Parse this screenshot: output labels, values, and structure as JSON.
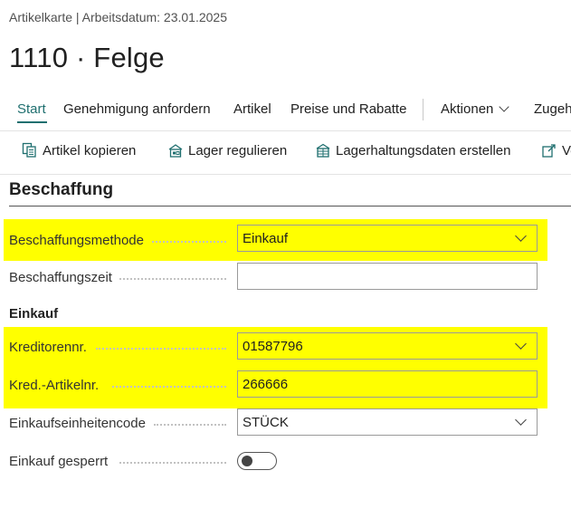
{
  "header": {
    "breadcrumb": "Artikelkarte | Arbeitsdatum: 23.01.2025",
    "title": "1110 · Felge"
  },
  "tabs": [
    {
      "label": "Start",
      "active": true
    },
    {
      "label": "Genehmigung anfordern"
    },
    {
      "label": "Artikel"
    },
    {
      "label": "Preise und Rabatte"
    },
    {
      "label": "Aktionen"
    },
    {
      "label": "Zugeh"
    }
  ],
  "actions": [
    {
      "label": "Artikel kopieren",
      "icon": "copy-document-icon"
    },
    {
      "label": "Lager regulieren",
      "icon": "adjust-inventory-icon"
    },
    {
      "label": "Lagerhaltungsdaten erstellen",
      "icon": "create-stockkeeping-icon"
    },
    {
      "label": "Vo",
      "icon": "open-external-icon"
    }
  ],
  "section": {
    "title": "Beschaffung",
    "subheading": "Einkauf"
  },
  "fields": {
    "beschaffungsmethode": {
      "label": "Beschaffungsmethode",
      "value": "Einkauf",
      "highlighted": true
    },
    "beschaffungszeit": {
      "label": "Beschaffungszeit",
      "value": ""
    },
    "kreditorennr": {
      "label": "Kreditorennr.",
      "value": "01587796",
      "highlighted": true
    },
    "kred_artikelnr": {
      "label": "Kred.-Artikelnr.",
      "value": "266666",
      "highlighted": true
    },
    "einkaufseinheitencode": {
      "label": "Einkaufseinheitencode",
      "value": "STÜCK"
    },
    "einkauf_gesperrt": {
      "label": "Einkauf gesperrt",
      "value": false
    }
  },
  "colors": {
    "highlight": "#ffff00",
    "accent": "#1f6f6f"
  }
}
